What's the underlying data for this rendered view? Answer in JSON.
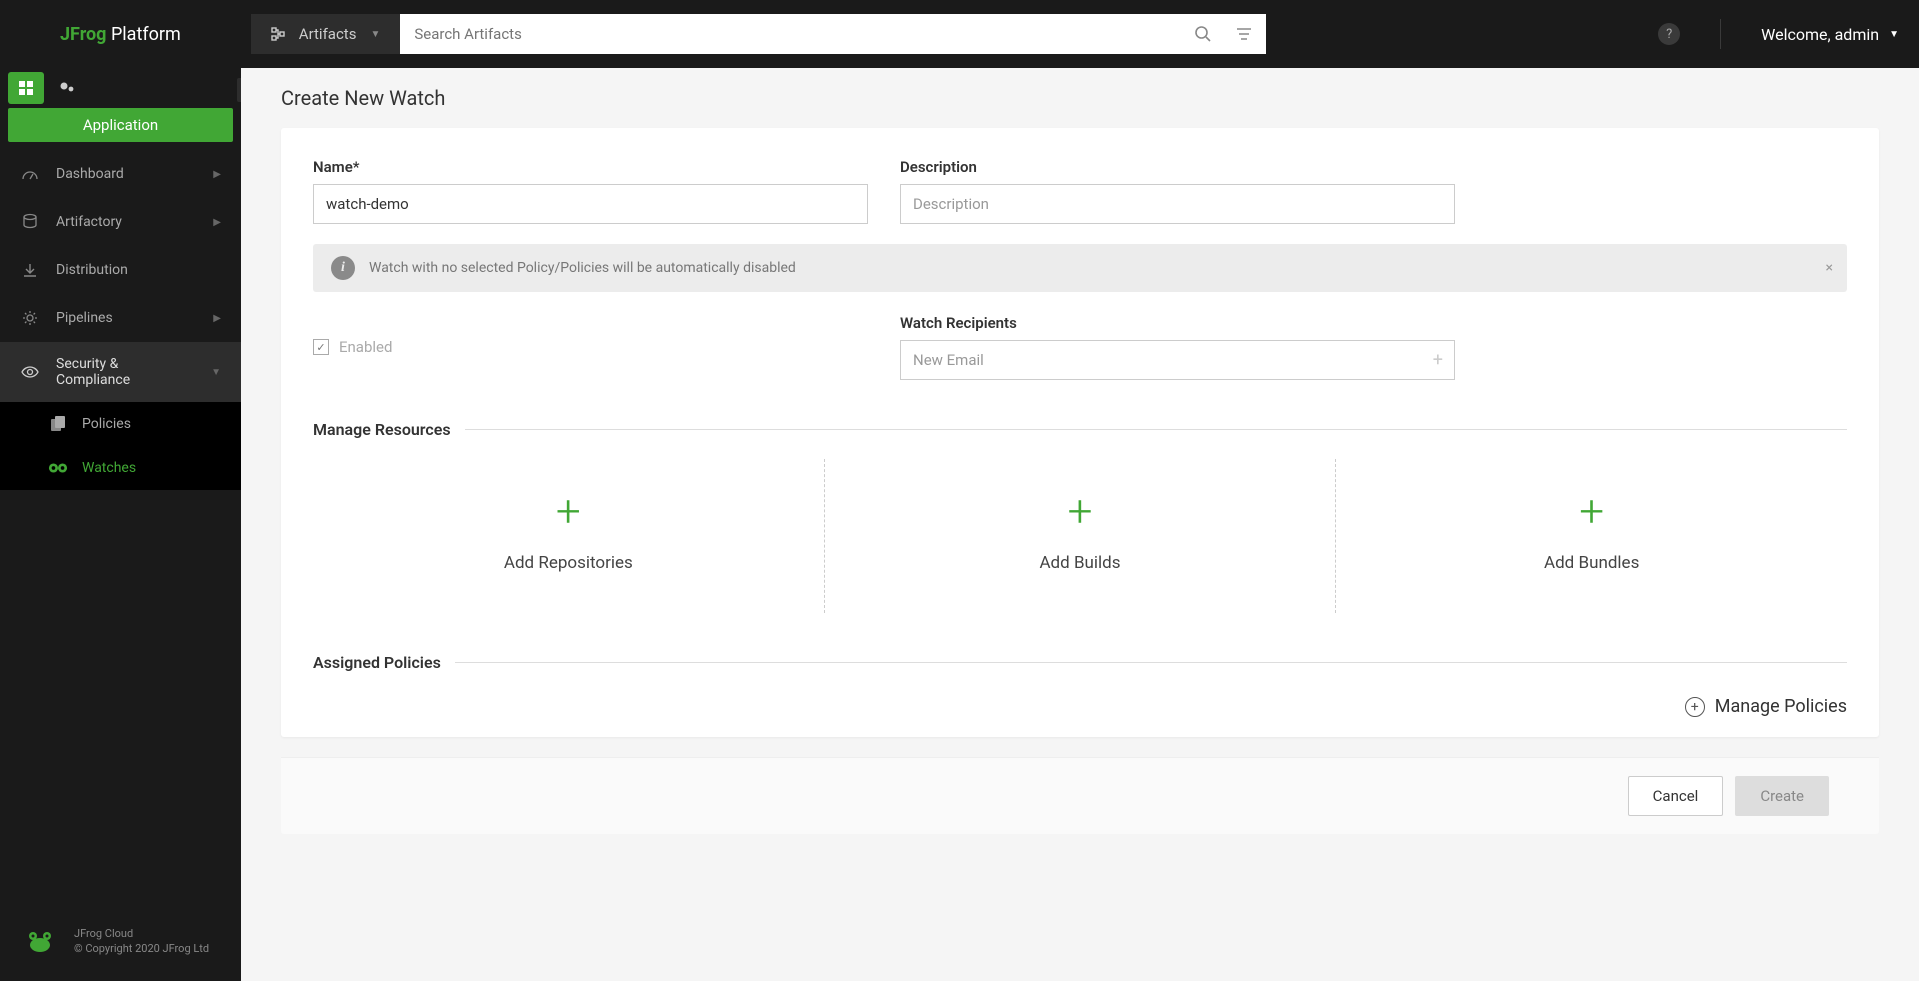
{
  "header": {
    "logo_bold": "JFrog",
    "logo_rest": " Platform",
    "search_context": "Artifacts",
    "search_placeholder": "Search Artifacts",
    "welcome": "Welcome, admin"
  },
  "sidebar": {
    "application_label": "Application",
    "items": [
      {
        "label": "Dashboard",
        "icon": "gauge",
        "chev": true
      },
      {
        "label": "Artifactory",
        "icon": "artifactory",
        "chev": true
      },
      {
        "label": "Distribution",
        "icon": "download",
        "chev": false
      },
      {
        "label": "Pipelines",
        "icon": "gear",
        "chev": true
      },
      {
        "label": "Security & Compliance",
        "icon": "eye",
        "chev": true,
        "active": true
      }
    ],
    "sub_items": [
      {
        "label": "Policies",
        "active": false
      },
      {
        "label": "Watches",
        "active": true
      }
    ],
    "footer_line1": "JFrog Cloud",
    "footer_line2": "© Copyright 2020 JFrog Ltd"
  },
  "page": {
    "title": "Create New Watch",
    "name_label": "Name*",
    "name_value": "watch-demo",
    "description_label": "Description",
    "description_placeholder": "Description",
    "info_text": "Watch with no selected Policy/Policies will be automatically disabled",
    "enabled_label": "Enabled",
    "enabled_checked": true,
    "recipients_label": "Watch Recipients",
    "recipients_placeholder": "New Email",
    "resources_header": "Manage Resources",
    "resources": [
      {
        "label": "Add Repositories"
      },
      {
        "label": "Add Builds"
      },
      {
        "label": "Add Bundles"
      }
    ],
    "policies_header": "Assigned Policies",
    "manage_policies": "Manage Policies",
    "cancel": "Cancel",
    "create": "Create"
  }
}
